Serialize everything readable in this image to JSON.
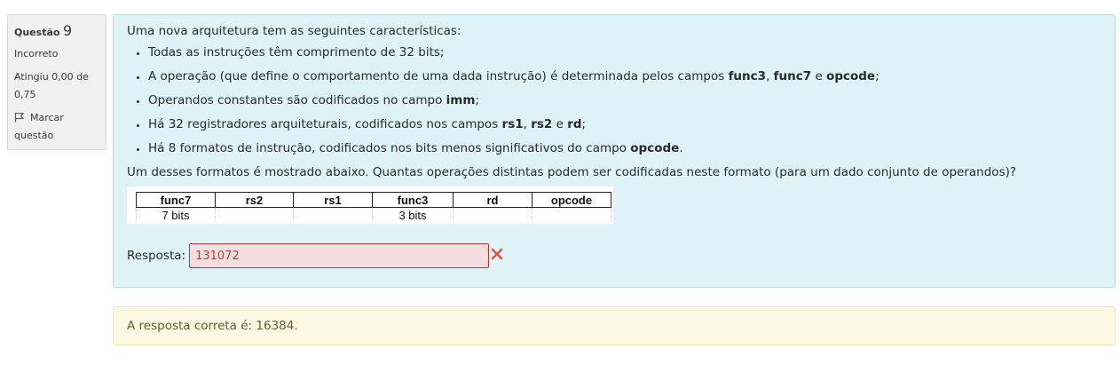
{
  "info": {
    "question_label": "Questão",
    "question_number": "9",
    "state": "Incorreto",
    "grade_line1": "Atingiu 0,00 de",
    "grade_line2": "0,75",
    "flag_line1": "Marcar",
    "flag_line2": "questão"
  },
  "question": {
    "intro": "Uma nova arquitetura tem as seguintes características:",
    "bullets": [
      [
        {
          "t": "Todas as instruções têm comprimento de 32 bits;"
        }
      ],
      [
        {
          "t": "A operação (que define o comportamento de uma dada instrução) é determinada pelos campos "
        },
        {
          "t": "func3",
          "b": true
        },
        {
          "t": ", "
        },
        {
          "t": "func7",
          "b": true
        },
        {
          "t": " e "
        },
        {
          "t": "opcode",
          "b": true
        },
        {
          "t": ";"
        }
      ],
      [
        {
          "t": "Operandos constantes são codificados no campo "
        },
        {
          "t": "imm",
          "b": true
        },
        {
          "t": ";"
        }
      ],
      [
        {
          "t": "Há 32 registradores arquiteturais, codificados nos campos "
        },
        {
          "t": "rs1",
          "b": true
        },
        {
          "t": ", "
        },
        {
          "t": "rs2",
          "b": true
        },
        {
          "t": " e "
        },
        {
          "t": "rd",
          "b": true
        },
        {
          "t": ";"
        }
      ],
      [
        {
          "t": "Há 8 formatos de instrução, codificados nos bits menos significativos do campo "
        },
        {
          "t": "opcode",
          "b": true
        },
        {
          "t": "."
        }
      ]
    ],
    "prompt": "Um desses formatos é mostrado abaixo. Quantas operações distintas podem ser codificadas neste formato (para um dado conjunto de operandos)?",
    "format_table": {
      "headers": [
        "func7",
        "rs2",
        "rs1",
        "func3",
        "rd",
        "opcode"
      ],
      "bits": [
        "7 bits",
        "",
        "",
        "3 bits",
        "",
        ""
      ]
    }
  },
  "answer": {
    "label": "Resposta:",
    "value": "131072",
    "status_icon": "incorrect-x-icon"
  },
  "feedback": {
    "correct_answer_text": "A resposta correta é: 16384."
  },
  "colors": {
    "formulation_bg": "#def2f8",
    "info_bg": "#f0f0f0",
    "incorrect_input_bg": "#f2dede",
    "incorrect_red": "#d9534f",
    "feedback_bg": "#fcf8e3"
  }
}
